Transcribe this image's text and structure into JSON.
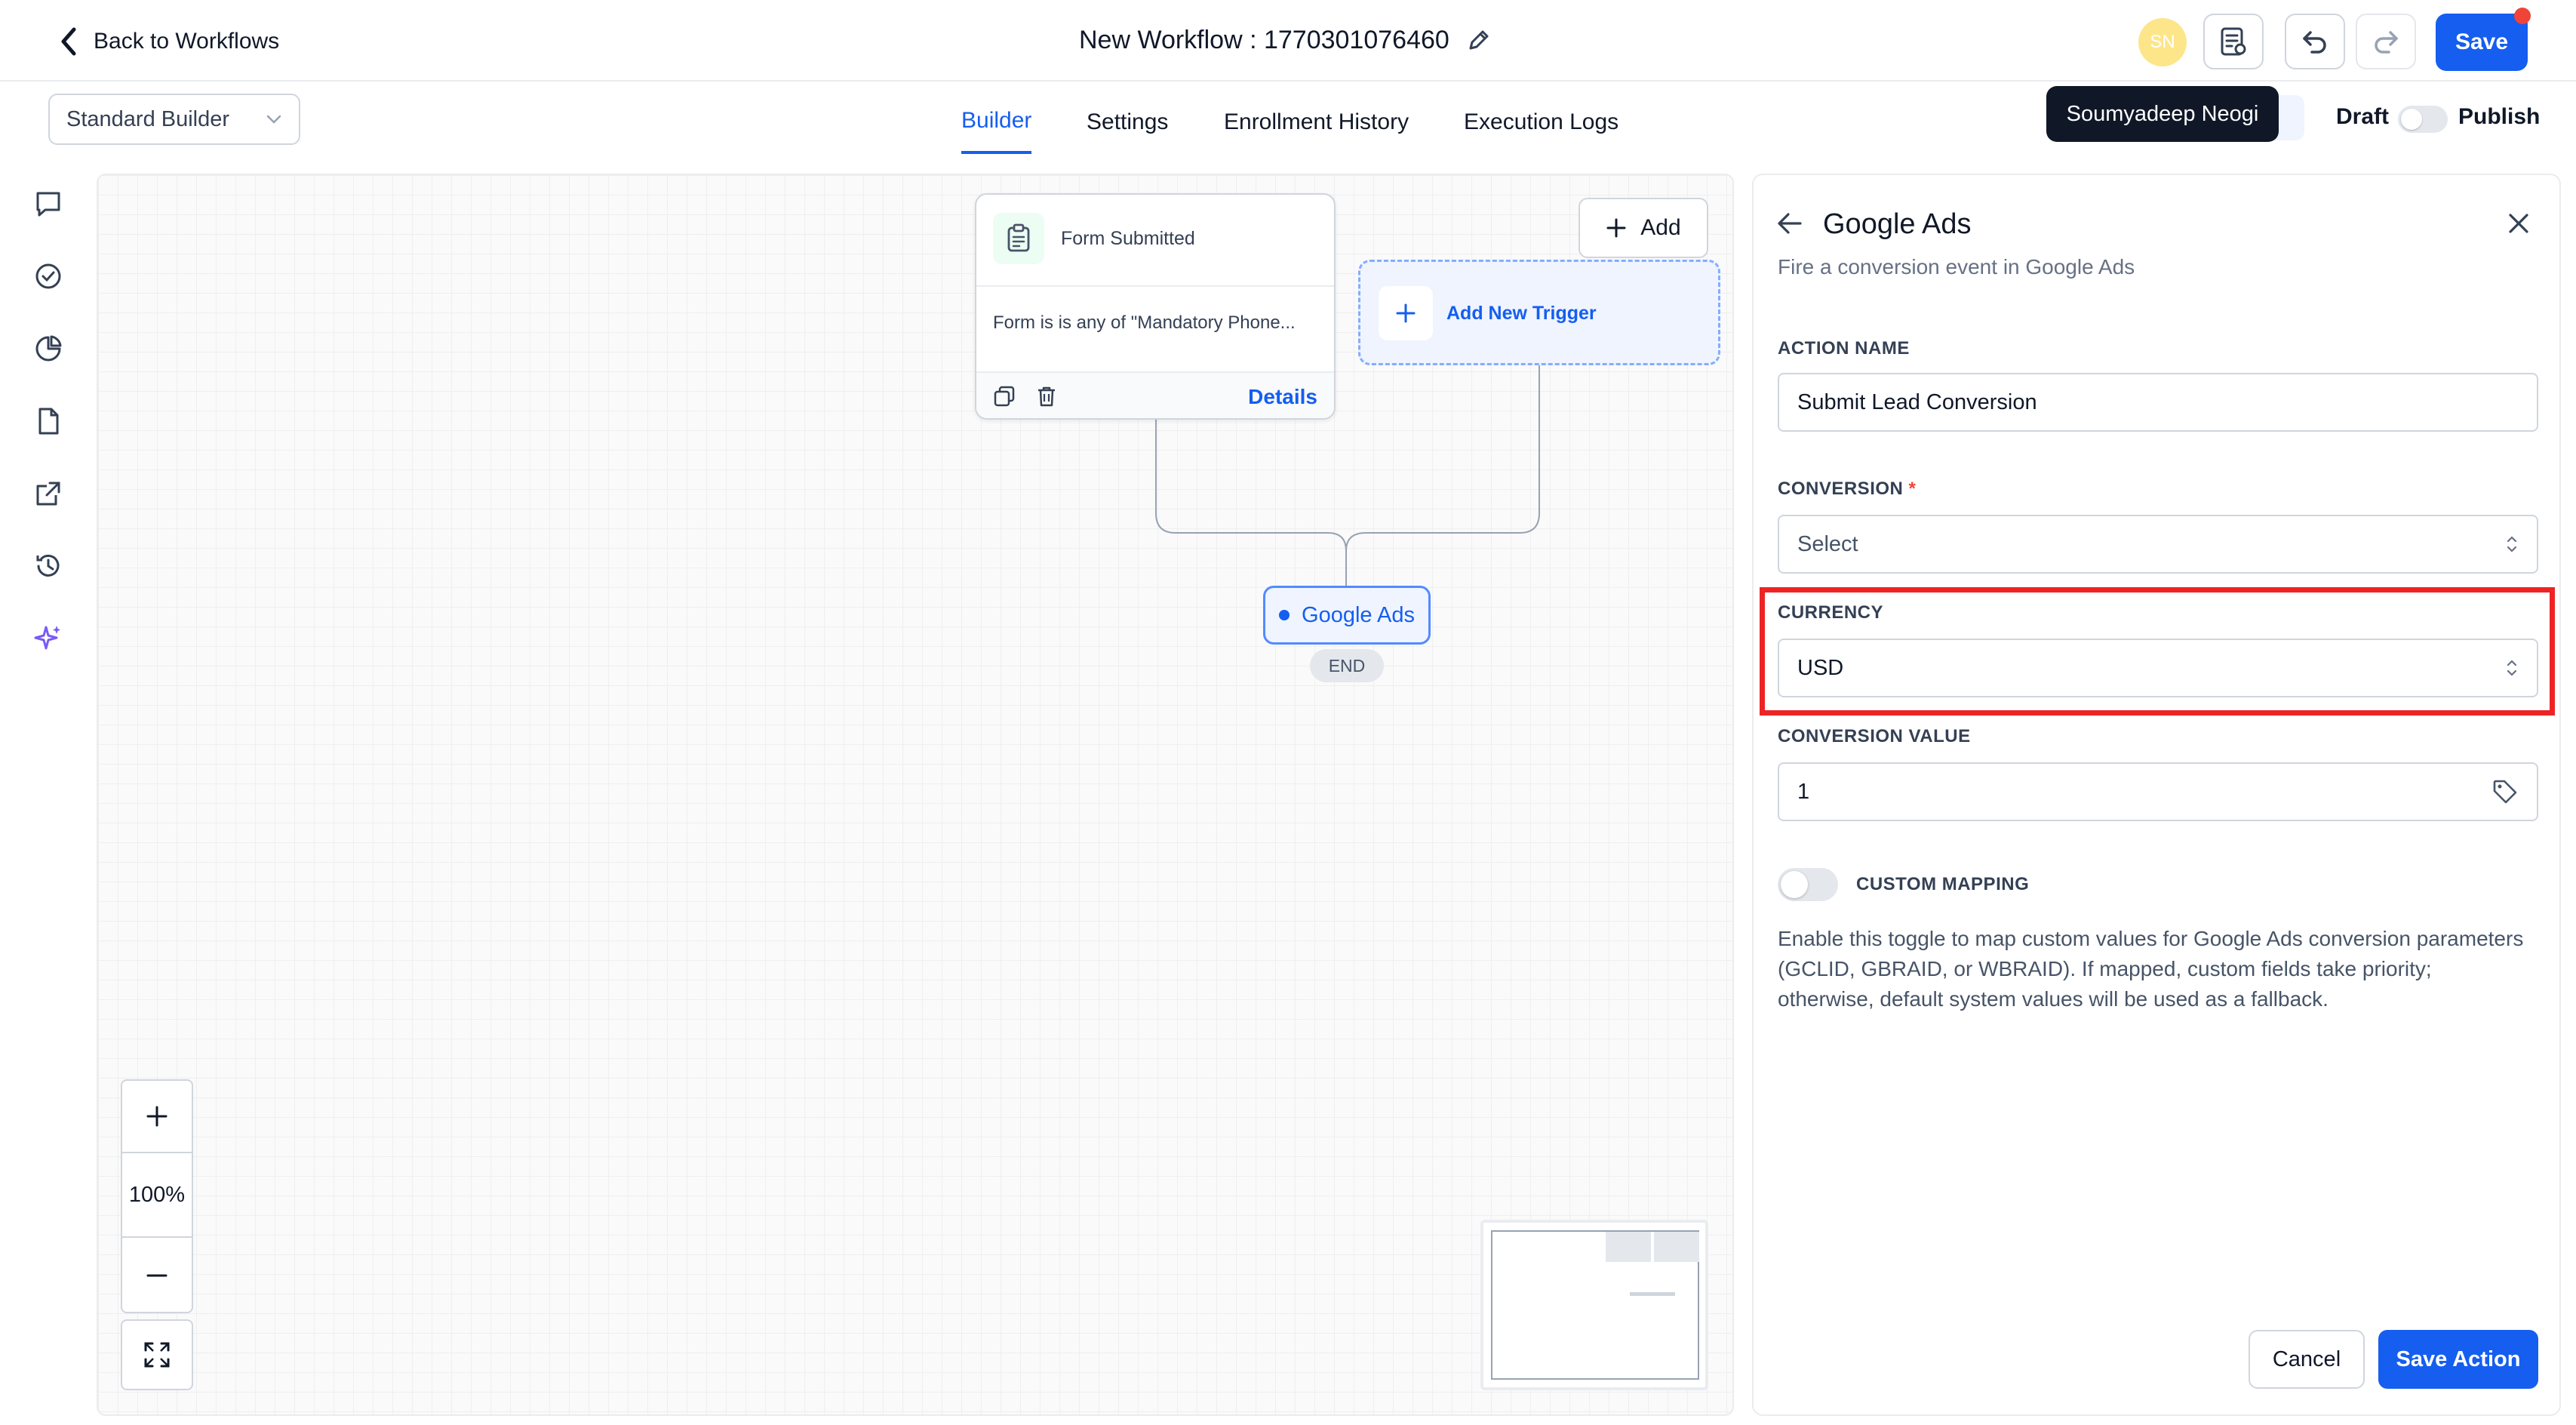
{
  "header": {
    "back_label": "Back to Workflows",
    "workflow_title": "New Workflow : 1770301076460",
    "avatar_initials": "SN",
    "save_label": "Save"
  },
  "subheader": {
    "builder_select_value": "Standard Builder",
    "tabs": [
      {
        "label": "Builder",
        "active": true
      },
      {
        "label": "Settings",
        "active": false
      },
      {
        "label": "Enrollment History",
        "active": false
      },
      {
        "label": "Execution Logs",
        "active": false
      }
    ],
    "tooltip_user": "Soumyadeep Neogi",
    "draft_label": "Draft",
    "publish_label": "Publish",
    "publish_on": false
  },
  "left_rail": {
    "icons": [
      "chat-icon",
      "check-circle-icon",
      "pie-chart-icon",
      "document-icon",
      "external-link-icon",
      "history-icon",
      "sparkle-icon"
    ]
  },
  "canvas": {
    "trigger": {
      "title": "Form Submitted",
      "description": "Form is is any of \"Mandatory Phone...",
      "details_label": "Details"
    },
    "add_label": "Add",
    "add_trigger_label": "Add New Trigger",
    "action_node_label": "Google Ads",
    "end_label": "END",
    "zoom_level": "100%"
  },
  "panel": {
    "title": "Google Ads",
    "subtitle": "Fire a conversion event in Google Ads",
    "action_name_label": "ACTION NAME",
    "action_name_value": "Submit Lead Conversion",
    "conversion_label": "CONVERSION",
    "conversion_required_mark": "*",
    "conversion_value": "Select",
    "currency_label": "CURRENCY",
    "currency_value": "USD",
    "conversion_value_label": "CONVERSION VALUE",
    "conversion_value_value": "1",
    "custom_mapping_label": "CUSTOM MAPPING",
    "custom_mapping_on": false,
    "custom_mapping_help": "Enable this toggle to map custom values for Google Ads conversion parameters (GCLID, GBRAID, or WBRAID). If mapped, custom fields take priority; otherwise, default system values will be used as a fallback.",
    "cancel_label": "Cancel",
    "save_action_label": "Save Action"
  },
  "colors": {
    "primary": "#155eef",
    "highlight": "#ee2424",
    "avatar": "#fde68a",
    "notification_dot": "#f04438"
  }
}
